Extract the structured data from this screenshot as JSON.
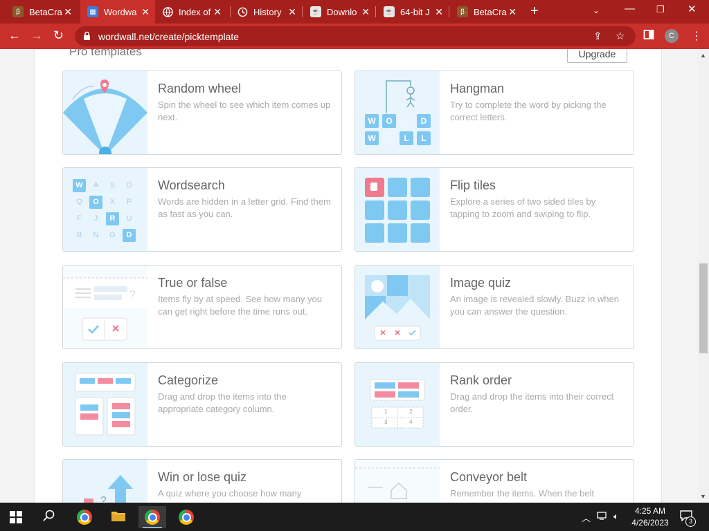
{
  "browser": {
    "tabs": [
      {
        "title": "BetaCra",
        "favicon": "beta-favicon"
      },
      {
        "title": "Wordwa",
        "favicon": "wordwall-favicon"
      },
      {
        "title": "Index of",
        "favicon": "globe-icon"
      },
      {
        "title": "History",
        "favicon": "history-icon"
      },
      {
        "title": "Downlo",
        "favicon": "java-favicon"
      },
      {
        "title": "64-bit J",
        "favicon": "java-favicon"
      },
      {
        "title": "BetaCra",
        "favicon": "beta-favicon"
      }
    ],
    "active_tab": 1,
    "url": "wordwall.net/create/picktemplate",
    "profile_initial": "C",
    "colors": {
      "frame": "#a5201c",
      "toolbar": "#c9302c"
    }
  },
  "page": {
    "section_title": "Pro templates",
    "upgrade_label": "Upgrade",
    "templates": [
      {
        "title": "Random wheel",
        "desc": "Spin the wheel to see which item comes up next."
      },
      {
        "title": "Hangman",
        "desc": "Try to complete the word by picking the correct letters."
      },
      {
        "title": "Wordsearch",
        "desc": "Words are hidden in a letter grid. Find them as fast as you can."
      },
      {
        "title": "Flip tiles",
        "desc": "Explore a series of two sided tiles by tapping to zoom and swiping to flip."
      },
      {
        "title": "True or false",
        "desc": "Items fly by at speed. See how many you can get right before the time runs out."
      },
      {
        "title": "Image quiz",
        "desc": "An image is revealed slowly. Buzz in when you can answer the question."
      },
      {
        "title": "Categorize",
        "desc": "Drag and drop the items into the appropriate category column."
      },
      {
        "title": "Rank order",
        "desc": "Drag and drop the items into their correct order."
      },
      {
        "title": "Win or lose quiz",
        "desc": "A quiz where you choose how many"
      },
      {
        "title": "Conveyor belt",
        "desc": "Remember the items. When the belt"
      }
    ],
    "hangman_letters": [
      "W",
      "O",
      "",
      "D",
      "W",
      "",
      "L",
      "L"
    ],
    "wordsearch_letters": [
      "W",
      "A",
      "S",
      "O",
      "Q",
      "O",
      "X",
      "P",
      "F",
      "J",
      "R",
      "U",
      "B",
      "N",
      "G",
      "D"
    ],
    "rank_numbers": [
      "1",
      "2",
      "3",
      "4"
    ]
  },
  "taskbar": {
    "time": "4:25 AM",
    "date": "4/26/2023",
    "notification_count": "3"
  }
}
